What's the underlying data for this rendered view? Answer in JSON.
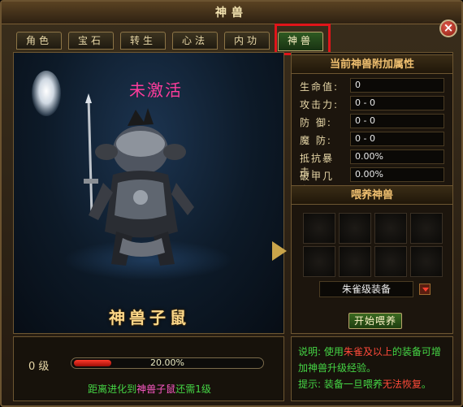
{
  "window": {
    "title": "神兽"
  },
  "tabs": [
    {
      "label": "角色",
      "active": false
    },
    {
      "label": "宝石",
      "active": false
    },
    {
      "label": "转生",
      "active": false
    },
    {
      "label": "心法",
      "active": false
    },
    {
      "label": "内功",
      "active": false
    },
    {
      "label": "神兽",
      "active": true
    }
  ],
  "pet": {
    "status": "未激活",
    "name": "神兽子鼠",
    "level_label": "0 级",
    "xp_percent_text": "20.00%",
    "xp_fraction": 0.2,
    "evolve_prefix": "距离进化到",
    "evolve_target": "神兽子鼠",
    "evolve_suffix": "还需1级"
  },
  "attributes": {
    "title": "当前神兽附加属性",
    "rows": [
      {
        "label": "生命值:",
        "value": "0"
      },
      {
        "label": "攻击力:",
        "value": "0 - 0"
      },
      {
        "label": "防  御:",
        "value": "0 - 0"
      },
      {
        "label": "魔  防:",
        "value": "0 - 0"
      },
      {
        "label": "抵抗暴击:",
        "value": "0.00%"
      },
      {
        "label": "破甲几率:",
        "value": "0.00%"
      }
    ]
  },
  "feed": {
    "title": "喂养神兽",
    "slot_count": 8,
    "select_value": "朱雀级装备",
    "button_label": "开始喂养"
  },
  "info": {
    "line1_prefix": "说明: 使用",
    "line1_highlight": "朱雀及以上",
    "line1_suffix": "的装备可增",
    "line2": "加神兽升级经验。",
    "line3_prefix": "提示: 装备一旦喂养",
    "line3_highlight": "无法恢复",
    "line3_suffix": "。"
  },
  "colors": {
    "status": "#ff3c9c",
    "green_text": "#45d545",
    "highlight_red": "#ff4a3a",
    "tab_highlight_border": "#e0151a"
  },
  "icons": [
    "close-icon",
    "arrow-right-icon",
    "dropdown-arrow-icon",
    "spirit-wisp-icon"
  ]
}
